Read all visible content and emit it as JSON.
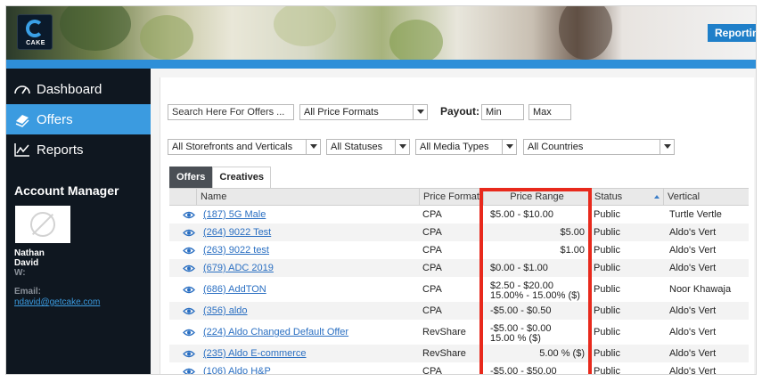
{
  "header": {
    "logo_text": "CAKE",
    "reporting_label": "Reporting"
  },
  "sidebar": {
    "items": [
      {
        "label": "Dashboard",
        "icon": "gauge-icon"
      },
      {
        "label": "Offers",
        "icon": "stack-icon"
      },
      {
        "label": "Reports",
        "icon": "line-chart-icon"
      }
    ],
    "account_manager_title": "Account Manager",
    "manager_first": "Nathan",
    "manager_last": "David",
    "w_label": "W:",
    "email_label": "Email:",
    "email": "ndavid@getcake.com"
  },
  "filters": {
    "search_placeholder": "Search Here For Offers ...",
    "price_formats": "All Price Formats",
    "payout_label": "Payout:",
    "min_placeholder": "Min",
    "max_placeholder": "Max",
    "storefronts": "All Storefronts and Verticals",
    "statuses": "All Statuses",
    "media_types": "All Media Types",
    "countries": "All Countries"
  },
  "tabs": [
    "Offers",
    "Creatives"
  ],
  "table": {
    "columns": [
      "Name",
      "Price Format",
      "Price Range",
      "Status",
      "Vertical"
    ],
    "rows": [
      {
        "name": "(187) 5G Male",
        "format": "CPA",
        "range1": "$5.00 - $10.00",
        "range2": "",
        "align": "left",
        "status": "Public",
        "vertical": "Turtle Vertle"
      },
      {
        "name": "(264) 9022 Test",
        "format": "CPA",
        "range1": "$5.00",
        "range2": "",
        "align": "right",
        "status": "Public",
        "vertical": "Aldo's Vert"
      },
      {
        "name": "(263) 9022 test",
        "format": "CPA",
        "range1": "$1.00",
        "range2": "",
        "align": "right",
        "status": "Public",
        "vertical": "Aldo's Vert"
      },
      {
        "name": "(679) ADC 2019",
        "format": "CPA",
        "range1": "$0.00 - $1.00",
        "range2": "",
        "align": "left",
        "status": "Public",
        "vertical": "Aldo's Vert"
      },
      {
        "name": "(686) AddTON",
        "format": "CPA",
        "range1": "$2.50 - $20.00",
        "range2": "15.00% - 15.00% ($)",
        "align": "left",
        "status": "Public",
        "vertical": "Noor Khawaja"
      },
      {
        "name": "(356) aldo",
        "format": "CPA",
        "range1": "-$5.00 - $0.50",
        "range2": "",
        "align": "left",
        "status": "Public",
        "vertical": "Aldo's Vert"
      },
      {
        "name": "(224) Aldo Changed Default Offer",
        "format": "RevShare",
        "range1": "-$5.00 - $0.00",
        "range2": "15.00 % ($)",
        "align": "left",
        "status": "Public",
        "vertical": "Aldo's Vert"
      },
      {
        "name": "(235) Aldo E-commerce",
        "format": "RevShare",
        "range1": "5.00 % ($)",
        "range2": "",
        "align": "right",
        "status": "Public",
        "vertical": "Aldo's Vert"
      },
      {
        "name": "(106) Aldo H&P",
        "format": "CPA",
        "range1": "-$5.00 - $50.00",
        "range2": "",
        "align": "left",
        "status": "Public",
        "vertical": "Aldo's Vert"
      }
    ]
  },
  "colors": {
    "accent_blue": "#3b9be0",
    "highlight_red": "#e8291c",
    "sidebar_bg": "#0f1720"
  }
}
